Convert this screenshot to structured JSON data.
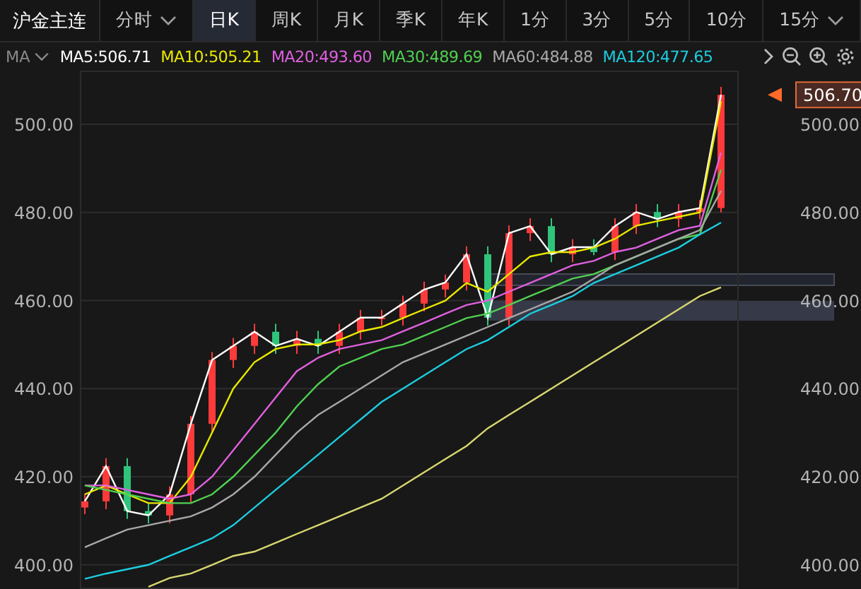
{
  "header": {
    "title": "沪金主连",
    "tabs": [
      {
        "label": "分时",
        "selected": false,
        "dropdown": true
      },
      {
        "label": "日K",
        "selected": true,
        "dropdown": false
      },
      {
        "label": "周K",
        "selected": false,
        "dropdown": false
      },
      {
        "label": "月K",
        "selected": false,
        "dropdown": false
      },
      {
        "label": "季K",
        "selected": false,
        "dropdown": false
      },
      {
        "label": "年K",
        "selected": false,
        "dropdown": false
      },
      {
        "label": "1分",
        "selected": false,
        "dropdown": false
      },
      {
        "label": "3分",
        "selected": false,
        "dropdown": false
      },
      {
        "label": "5分",
        "selected": false,
        "dropdown": false
      },
      {
        "label": "10分",
        "selected": false,
        "dropdown": false
      },
      {
        "label": "15分",
        "selected": false,
        "dropdown": true
      }
    ]
  },
  "indicator_bar": {
    "selector": "MA",
    "legend": [
      {
        "text": "MA5:506.71",
        "color": "#ffffff"
      },
      {
        "text": "MA10:505.21",
        "color": "#e8e800"
      },
      {
        "text": "MA20:493.60",
        "color": "#e060e0"
      },
      {
        "text": "MA30:489.69",
        "color": "#50d050"
      },
      {
        "text": "MA60:484.88",
        "color": "#a8a8a8"
      },
      {
        "text": "MA120:477.65",
        "color": "#1ccde0"
      }
    ]
  },
  "price_chart": {
    "chart_data": {
      "type": "candlestick",
      "grid": true,
      "ylim": [
        394.5,
        512.2
      ],
      "yticks": [
        {
          "value": 400,
          "label": "400.00"
        },
        {
          "value": 420,
          "label": "420.00"
        },
        {
          "value": 440,
          "label": "440.00"
        },
        {
          "value": 460,
          "label": "460.00"
        },
        {
          "value": 480,
          "label": "480.00"
        },
        {
          "value": 500,
          "label": "500.00"
        }
      ],
      "ohlc": [
        [
          413.0,
          416.2,
          411.5,
          414.4
        ],
        [
          414.4,
          424.2,
          412.6,
          422.4
        ],
        [
          422.4,
          424.2,
          410.4,
          412.2
        ],
        [
          412.2,
          414.0,
          409.4,
          411.2
        ],
        [
          411.2,
          417.8,
          409.4,
          416.0
        ],
        [
          416.0,
          433.8,
          414.2,
          432.0
        ],
        [
          432.0,
          448.3,
          430.2,
          446.5
        ],
        [
          446.5,
          451.5,
          444.7,
          449.7
        ],
        [
          449.7,
          454.7,
          447.9,
          452.9
        ],
        [
          452.9,
          454.7,
          447.9,
          449.7
        ],
        [
          449.7,
          453.1,
          447.9,
          451.3
        ],
        [
          451.3,
          453.1,
          447.9,
          449.7
        ],
        [
          449.7,
          454.7,
          447.9,
          452.9
        ],
        [
          452.9,
          457.9,
          451.1,
          456.1
        ],
        [
          456.1,
          457.9,
          454.3,
          456.1
        ],
        [
          456.1,
          461.1,
          454.3,
          459.3
        ],
        [
          459.3,
          464.3,
          457.5,
          462.5
        ],
        [
          462.5,
          465.9,
          460.7,
          464.1
        ],
        [
          464.1,
          472.3,
          462.3,
          470.5
        ],
        [
          470.5,
          472.3,
          454.3,
          456.1
        ],
        [
          456.1,
          477.1,
          454.3,
          475.3
        ],
        [
          475.3,
          478.7,
          473.5,
          476.9
        ],
        [
          476.9,
          478.7,
          468.7,
          470.5
        ],
        [
          470.5,
          473.9,
          468.7,
          472.1
        ],
        [
          472.1,
          473.9,
          470.3,
          471.0
        ],
        [
          471.0,
          478.7,
          469.2,
          476.9
        ],
        [
          476.9,
          481.9,
          475.1,
          480.1
        ],
        [
          480.1,
          481.9,
          476.7,
          478.5
        ],
        [
          478.5,
          481.9,
          476.7,
          480.1
        ],
        [
          480.1,
          482.8,
          478.5,
          481.0
        ],
        [
          481.0,
          508.5,
          480.0,
          506.7
        ]
      ]
    }
  },
  "average_chart": {
    "last_price": "506.70",
    "chart_data": {
      "type": "line",
      "ylim": [
        394.5,
        512.2
      ],
      "yticks": [
        {
          "value": 400,
          "label": "400.00"
        },
        {
          "value": 420,
          "label": "420.00"
        },
        {
          "value": 440,
          "label": "440.00"
        },
        {
          "value": 460,
          "label": "460.00"
        },
        {
          "value": 480,
          "label": "480.00"
        },
        {
          "value": 500,
          "label": "500.00"
        }
      ],
      "series": [
        {
          "color": "#ffffff",
          "values": [
            414.4,
            422.4,
            412.2,
            411.2,
            416,
            432,
            446.5,
            449.7,
            452.9,
            449.7,
            451.3,
            449.7,
            452.9,
            456.1,
            456.1,
            459.3,
            462.5,
            464.1,
            470.5,
            456.1,
            475.3,
            476.9,
            470.5,
            472.1,
            472.1,
            476.9,
            480.1,
            478.5,
            480.1,
            481,
            506.7
          ]
        },
        {
          "color": "#e8e800",
          "values": [
            416,
            418,
            416,
            414,
            414,
            420,
            430,
            440,
            446,
            449,
            450,
            450,
            451,
            453,
            454,
            456,
            458,
            460,
            464,
            462,
            466,
            470,
            471,
            471,
            472,
            474,
            477,
            478,
            479,
            480,
            505.2
          ]
        },
        {
          "color": "#e060e0",
          "values": [
            418,
            418,
            417,
            416,
            415,
            416,
            420,
            426,
            432,
            438,
            444,
            447,
            449,
            450,
            451,
            453,
            455,
            457,
            459,
            460,
            462,
            464,
            466,
            468,
            469,
            471,
            472,
            474,
            476,
            477,
            493.6
          ]
        },
        {
          "color": "#50d050",
          "values": [
            418,
            417,
            416,
            415,
            414,
            414,
            416,
            420,
            425,
            430,
            436,
            441,
            445,
            447,
            449,
            450,
            452,
            454,
            456,
            457,
            459,
            461,
            463,
            465,
            466,
            468,
            470,
            472,
            474,
            475,
            489.7
          ]
        },
        {
          "color": "#a8a8a8",
          "values": [
            404,
            406,
            408,
            409,
            410,
            411,
            413,
            416,
            420,
            425,
            430,
            434,
            437,
            440,
            443,
            446,
            448,
            450,
            452,
            454,
            456,
            458,
            460,
            462,
            465,
            468,
            470,
            472,
            474,
            476,
            484.9
          ]
        },
        {
          "color": "#1ccde0",
          "values": [
            396.8,
            398,
            399,
            400,
            402,
            404,
            406,
            409,
            413,
            417,
            421,
            425,
            429,
            433,
            437,
            440,
            443,
            446,
            449,
            451,
            454,
            457,
            459,
            461,
            464,
            466,
            468,
            470,
            472,
            475,
            477.7
          ]
        },
        {
          "color": "#d8d870",
          "values": [
            null,
            null,
            null,
            395,
            397,
            398,
            400,
            402,
            403,
            405,
            407,
            409,
            411,
            413,
            415,
            418,
            421,
            424,
            427,
            431,
            434,
            437,
            440,
            443,
            446,
            449,
            452,
            455,
            458,
            461,
            463
          ]
        }
      ]
    }
  }
}
